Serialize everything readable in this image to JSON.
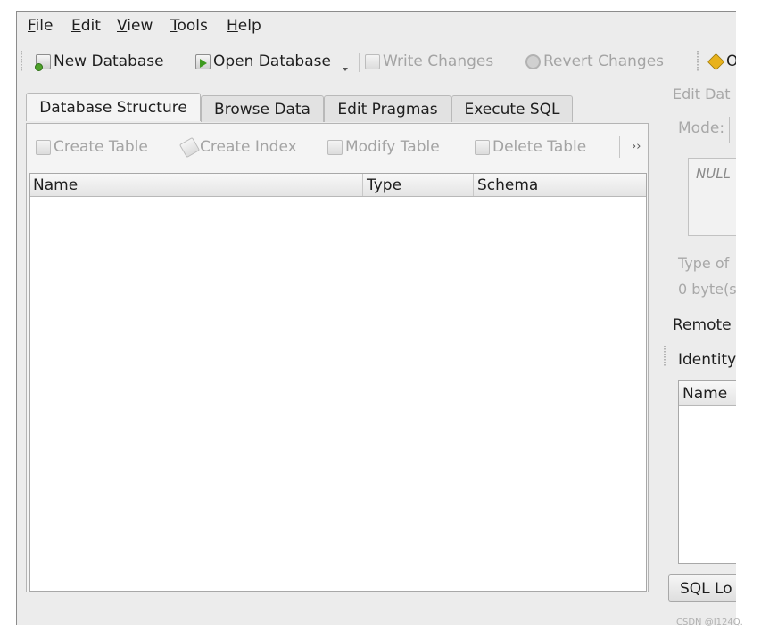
{
  "menu": {
    "file": {
      "mnemonic": "F",
      "rest": "ile"
    },
    "edit": {
      "mnemonic": "E",
      "rest": "dit"
    },
    "view": {
      "mnemonic": "V",
      "rest": "iew"
    },
    "tools": {
      "mnemonic": "T",
      "rest": "ools"
    },
    "help": {
      "mnemonic": "H",
      "rest": "elp"
    }
  },
  "toolbar": {
    "new_database": "New Database",
    "open_database": "Open Database",
    "write_changes": "Write Changes",
    "revert_changes": "Revert Changes",
    "open_project_partial": "O"
  },
  "tabs": [
    "Database Structure",
    "Browse Data",
    "Edit Pragmas",
    "Execute SQL"
  ],
  "structure_toolbar": {
    "create_table": "Create Table",
    "create_index": "Create Index",
    "modify_table": "Modify Table",
    "delete_table": "Delete Table",
    "more": "››"
  },
  "tree": {
    "columns": [
      "Name",
      "Type",
      "Schema"
    ]
  },
  "right_pane": {
    "edit_cell_title": "Edit Dat",
    "mode_label": "Mode:",
    "null_text": "NULL",
    "type_of": "Type of",
    "byte_count": "0 byte(s",
    "remote_title": "Remote",
    "identity_label": "Identity",
    "remote_column": "Name",
    "sql_log_button": "SQL Lo"
  },
  "watermark": "CSDN @I124Q.",
  "colors": {
    "window_bg": "#ececec",
    "disabled_text": "#a4a4a4",
    "icon_green": "#4ea12a"
  }
}
